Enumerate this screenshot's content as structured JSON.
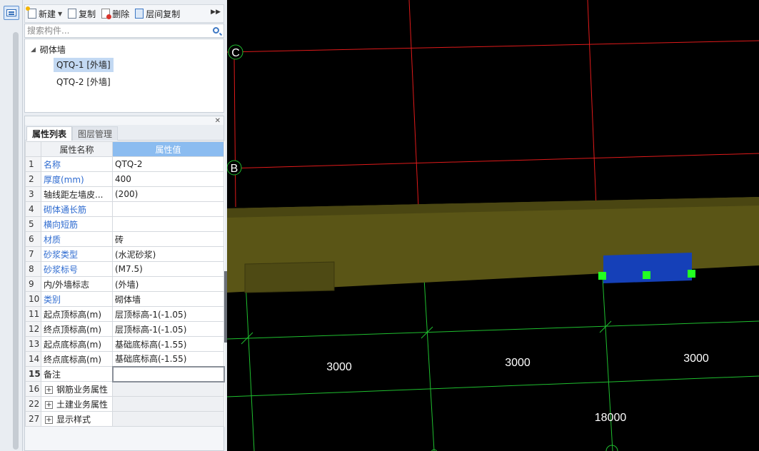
{
  "toolbar": {
    "new_label": "新建",
    "copy_label": "复制",
    "delete_label": "删除",
    "floor_copy_label": "层间复制"
  },
  "search": {
    "placeholder": "搜索构件..."
  },
  "tree": {
    "root_label": "砌体墙",
    "items": [
      {
        "label": "QTQ-1 [外墙]",
        "selected": true
      },
      {
        "label": "QTQ-2 [外墙]",
        "selected": false
      }
    ]
  },
  "prop_tabs": {
    "active": "属性列表",
    "inactive": "图层管理"
  },
  "prop_table": {
    "header_name": "属性名称",
    "header_value": "属性值",
    "rows": [
      {
        "num": "1",
        "name": "名称",
        "value": "QTQ-2",
        "blue": true
      },
      {
        "num": "2",
        "name": "厚度(mm)",
        "value": "400",
        "blue": true
      },
      {
        "num": "3",
        "name": "轴线距左墙皮...",
        "value": "(200)",
        "blue": false
      },
      {
        "num": "4",
        "name": "砌体通长筋",
        "value": "",
        "blue": true
      },
      {
        "num": "5",
        "name": "横向短筋",
        "value": "",
        "blue": true
      },
      {
        "num": "6",
        "name": "材质",
        "value": "砖",
        "blue": true
      },
      {
        "num": "7",
        "name": "砂浆类型",
        "value": "(水泥砂浆)",
        "blue": true
      },
      {
        "num": "8",
        "name": "砂浆标号",
        "value": "(M7.5)",
        "blue": true
      },
      {
        "num": "9",
        "name": "内/外墙标志",
        "value": "(外墙)",
        "blue": false
      },
      {
        "num": "10",
        "name": "类别",
        "value": "砌体墙",
        "blue": true
      },
      {
        "num": "11",
        "name": "起点顶标高(m)",
        "value": "层顶标高-1(-1.05)",
        "blue": false
      },
      {
        "num": "12",
        "name": "终点顶标高(m)",
        "value": "层顶标高-1(-1.05)",
        "blue": false
      },
      {
        "num": "13",
        "name": "起点底标高(m)",
        "value": "基础底标高(-1.55)",
        "blue": false
      },
      {
        "num": "14",
        "name": "终点底标高(m)",
        "value": "基础底标高(-1.55)",
        "blue": false
      },
      {
        "num": "15",
        "name": "备注",
        "value": "",
        "blue": false
      }
    ],
    "groups": [
      {
        "num": "16",
        "name": "钢筋业务属性"
      },
      {
        "num": "22",
        "name": "土建业务属性"
      },
      {
        "num": "27",
        "name": "显示样式"
      }
    ]
  },
  "viewport": {
    "axis_labels": {
      "c": "C",
      "b": "B"
    },
    "dimensions": {
      "d1": "3000",
      "d2": "3000",
      "d3": "3000",
      "total": "18000"
    },
    "colors": {
      "red_axis": "#e01a1a",
      "green_axis": "#1fbf2f",
      "wall": "#5a5516",
      "selected_wall": "#1540b8",
      "grip": "#22ff22"
    }
  }
}
